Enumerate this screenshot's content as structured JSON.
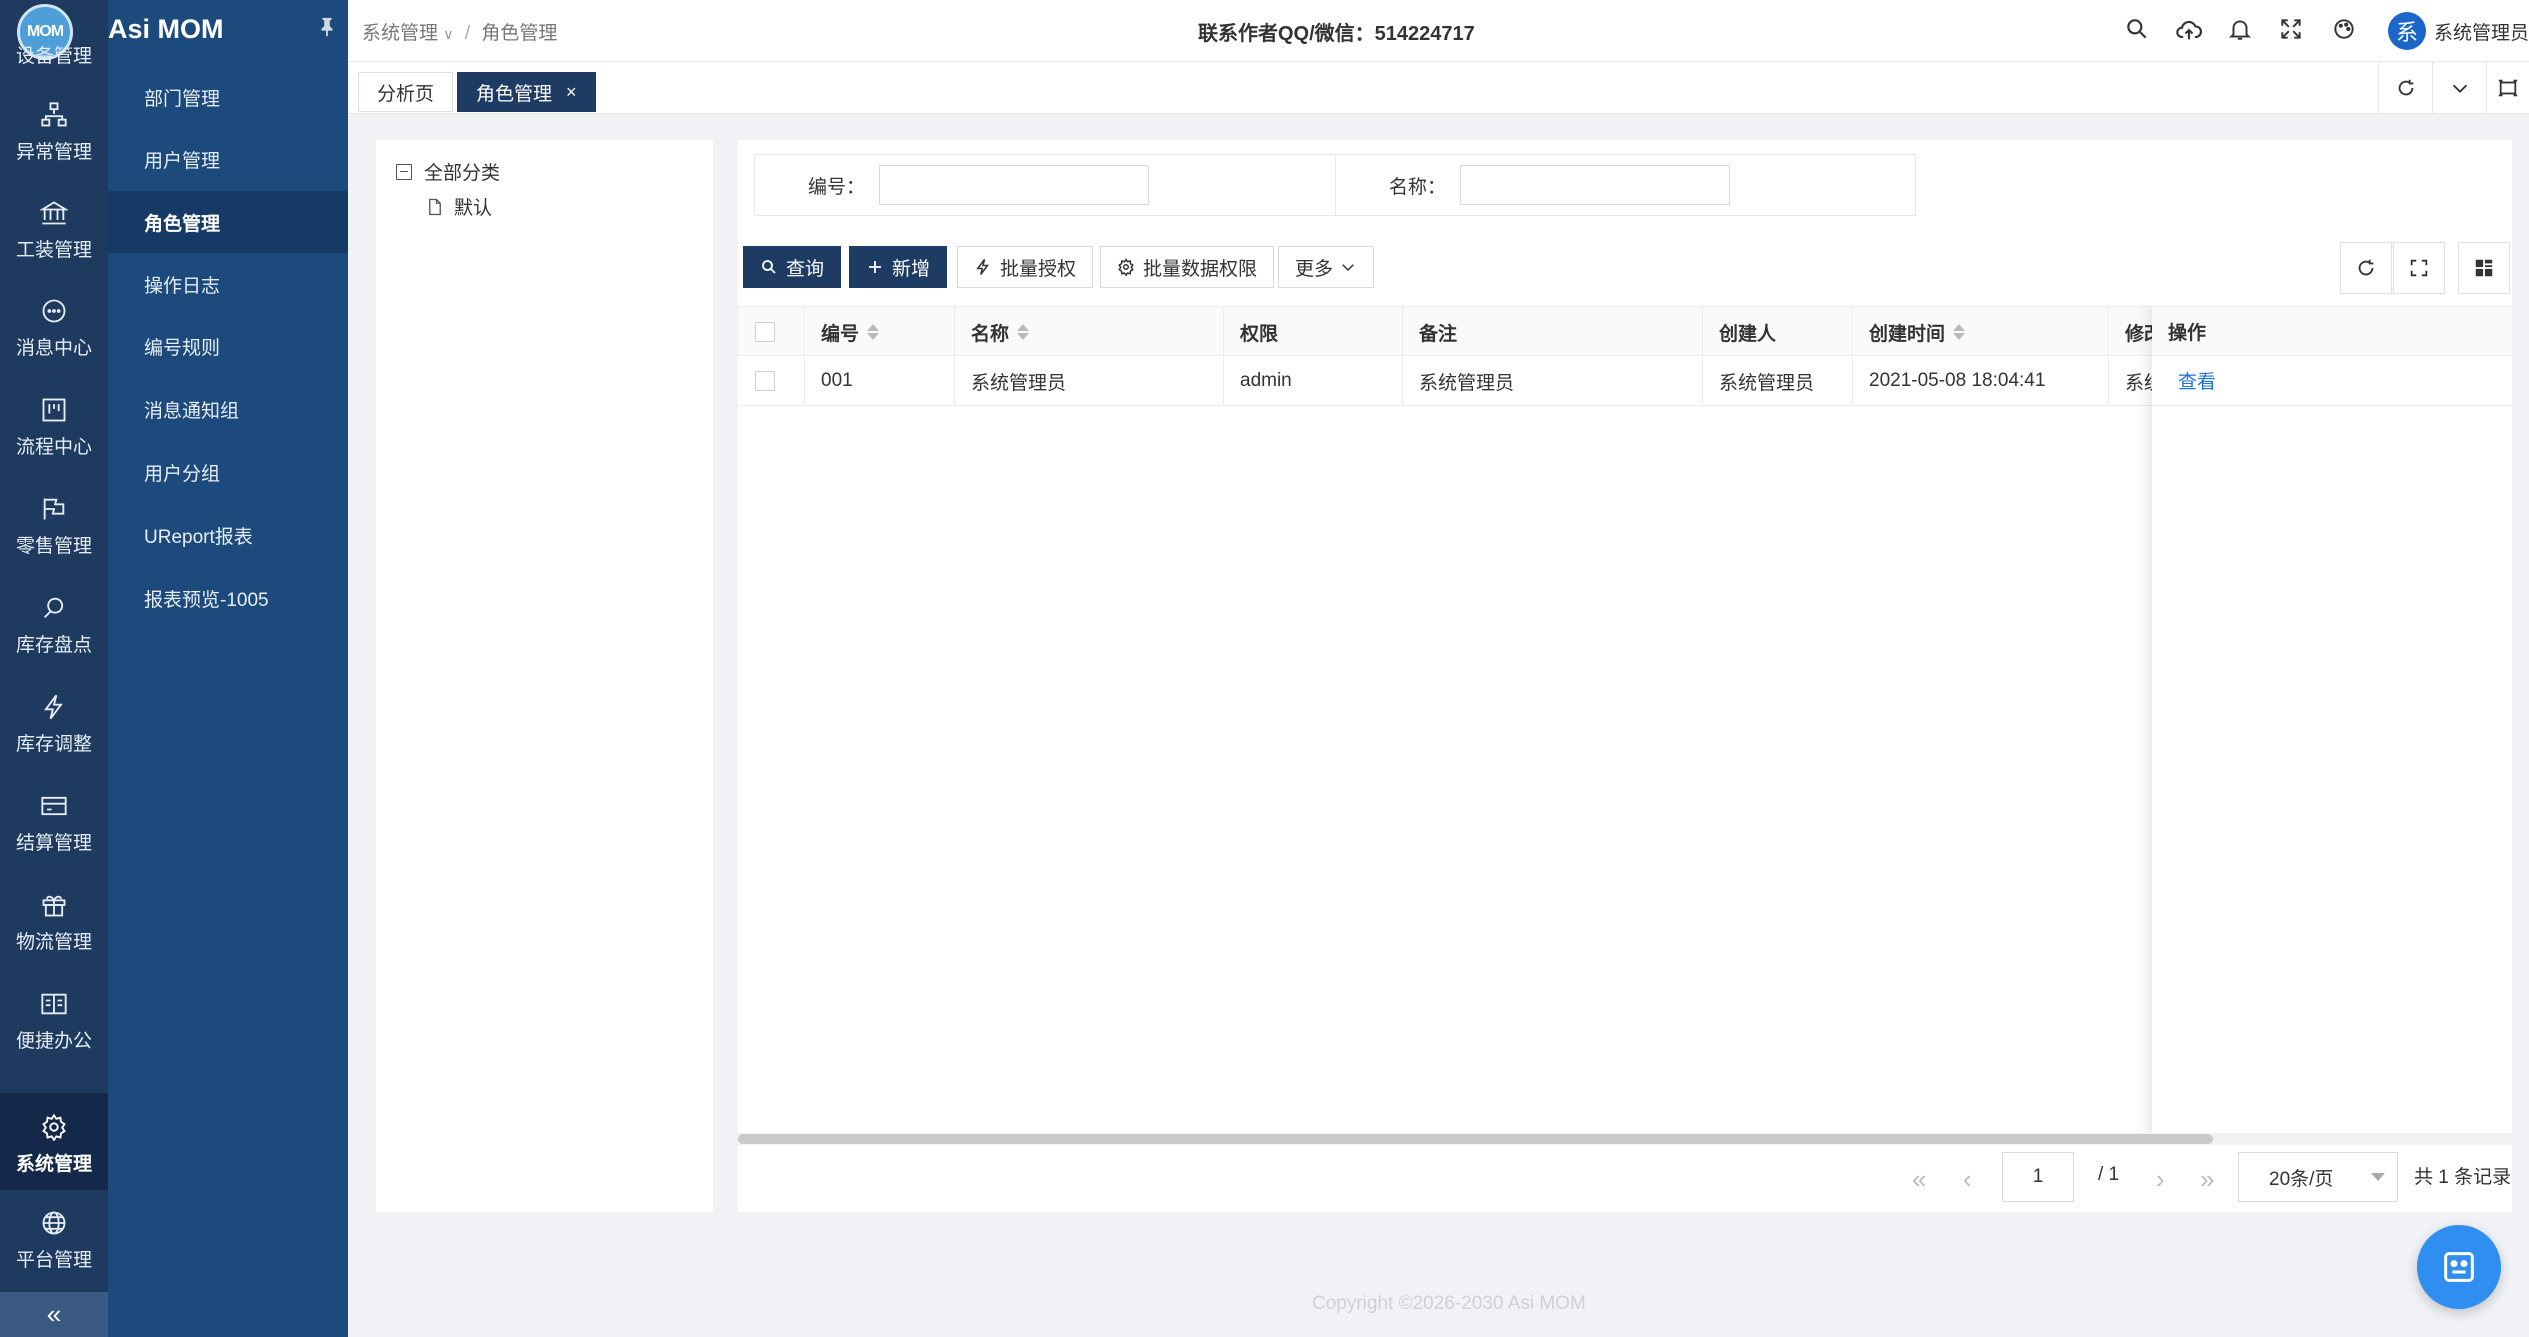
{
  "app": {
    "logo_text": "MOM",
    "title": "Asi MOM"
  },
  "rail": {
    "items": [
      {
        "label": "设备管理",
        "icon": "device-icon"
      },
      {
        "label": "异常管理",
        "icon": "sitemap-icon"
      },
      {
        "label": "工装管理",
        "icon": "bank-icon"
      },
      {
        "label": "消息中心",
        "icon": "message-icon"
      },
      {
        "label": "流程中心",
        "icon": "project-icon"
      },
      {
        "label": "零售管理",
        "icon": "flag-icon"
      },
      {
        "label": "库存盘点",
        "icon": "search-icon"
      },
      {
        "label": "库存调整",
        "icon": "thunder-icon"
      },
      {
        "label": "结算管理",
        "icon": "card-icon"
      },
      {
        "label": "物流管理",
        "icon": "gift-icon"
      },
      {
        "label": "便捷办公",
        "icon": "read-icon"
      },
      {
        "label": "系统管理",
        "icon": "setting-icon",
        "active": true
      },
      {
        "label": "平台管理",
        "icon": "global-icon"
      }
    ],
    "collapse_glyph": "«"
  },
  "submenu": {
    "items": [
      "部门管理",
      "用户管理",
      "角色管理",
      "操作日志",
      "编号规则",
      "消息通知组",
      "用户分组",
      "UReport报表",
      "报表预览-1005"
    ],
    "active_index": 2
  },
  "header": {
    "breadcrumb": [
      "系统管理",
      "角色管理"
    ],
    "contact": "联系作者QQ/微信：514224717",
    "user_name": "系统管理员",
    "avatar_char": "系"
  },
  "tabs": [
    {
      "label": "分析页",
      "active": false
    },
    {
      "label": "角色管理",
      "active": true,
      "close": "×"
    }
  ],
  "tree": {
    "root": "全部分类",
    "children": [
      "默认"
    ]
  },
  "search": {
    "code_label": "编号：",
    "code_value": "",
    "code_placeholder": "",
    "name_label": "名称：",
    "name_value": "",
    "name_placeholder": ""
  },
  "toolbar": {
    "query": "查询",
    "add": "新增",
    "batch_auth": "批量授权",
    "batch_data_auth": "批量数据权限",
    "more": "更多"
  },
  "table": {
    "columns": [
      "编号",
      "名称",
      "权限",
      "备注",
      "创建人",
      "创建时间",
      "修改",
      "操作"
    ],
    "rows": [
      {
        "code": "001",
        "name": "系统管理员",
        "perm": "admin",
        "remark": "系统管理员",
        "creator": "系统管理员",
        "created": "2021-05-08 18:04:41",
        "modifier": "系统",
        "action": "查看"
      }
    ]
  },
  "pager": {
    "page": "1",
    "total_pages": "/ 1",
    "page_size": "20条/页",
    "total": "共 1 条记录"
  },
  "footer": {
    "copyright": "Copyright ©2026-2030 Asi MOM"
  },
  "colors": {
    "rail_bg": "#1f3a5f",
    "submenu_bg": "#1c4a7c",
    "primary": "#1e3b63",
    "link": "#1e73d8"
  }
}
